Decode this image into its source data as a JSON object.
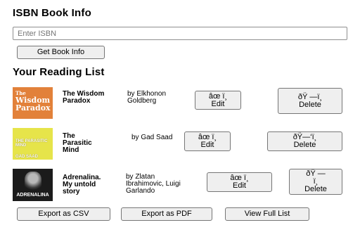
{
  "header": {
    "title": "ISBN Book Info"
  },
  "search": {
    "placeholder": "Enter ISBN",
    "button_label": "Get Book Info"
  },
  "reading_list": {
    "heading": "Your Reading List",
    "books": [
      {
        "cover": {
          "line1": "The",
          "line2": "Wisdom",
          "line3": "Paradox",
          "bg": "#e2813a"
        },
        "title": "The Wisdom Paradox",
        "author": "by Elkhonon Goldberg",
        "edit_icon": "âœ ï¸",
        "edit_label": "Edit",
        "delete_icon": "ðŸ —ï¸",
        "delete_label": "Delete"
      },
      {
        "cover": {
          "line1": "THE PARASITIC MIND",
          "line2": "GAD SAAD",
          "bg": "#e6e44a"
        },
        "title": "The Parasitic Mind",
        "author": "by Gad Saad",
        "edit_icon": "âœ ï¸",
        "edit_label": "Edit",
        "delete_icon": "ðŸ—‘ï¸",
        "delete_label": "Delete"
      },
      {
        "cover": {
          "line1": "ADRENALINA",
          "bg": "#1b1b1b"
        },
        "title": "Adrenalina. My untold story",
        "author": "by Zlatan Ibrahimovic, Luigi Garlando",
        "edit_icon": "âœ ï¸",
        "edit_label": "Edit",
        "delete_icon": "ðŸ —ï¸",
        "delete_label": "Delete"
      }
    ]
  },
  "footer": {
    "export_csv": "Export as CSV",
    "export_pdf": "Export as PDF",
    "view_full": "View Full List"
  }
}
